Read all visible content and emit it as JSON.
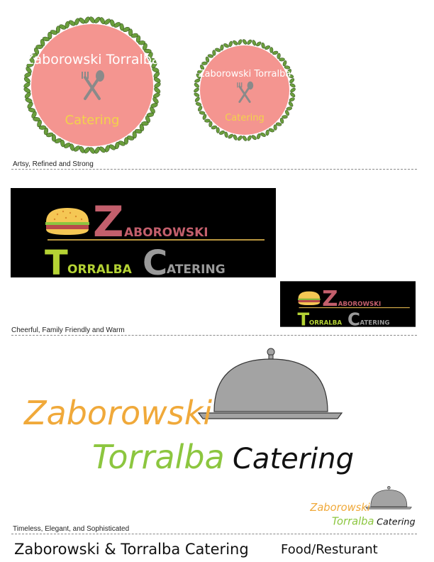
{
  "section1": {
    "brand_line1": "Zaborowski Torralba",
    "brand_line2": "Catering",
    "caption": "Artsy, Refined and Strong",
    "colors": {
      "circle": "#f49590",
      "leaves": "#6a9e3c",
      "brand_text": "#ffffff",
      "catering_text": "#f2d34a",
      "utensils": "#8a8a8a"
    }
  },
  "section2": {
    "word_z": "Z",
    "word_aborowski": "ABOROWSKI",
    "word_t": "T",
    "word_orralba": "ORRALBA",
    "word_c": "C",
    "word_atering": "ATERING",
    "caption": "Cheerful, Family Friendly and Warm",
    "colors": {
      "background": "#000000",
      "z": "#c35f6c",
      "t": "#b5d334",
      "c": "#9a9a9a",
      "bun": "#f5c754",
      "lettuce": "#8cc63f",
      "patty": "#b94a4a",
      "line": "#f5c754"
    }
  },
  "section3": {
    "word1": "Zaborowski",
    "word2": "Torralba",
    "word3": "Catering",
    "caption": "Timeless, Elegant, and Sophisticated",
    "colors": {
      "word1": "#f0a93a",
      "word2": "#8cc63f",
      "word3": "#111111",
      "cloche": "#a3a3a3"
    }
  },
  "footer": {
    "title": "Zaborowski & Torralba Catering",
    "category": "Food/Resturant"
  }
}
